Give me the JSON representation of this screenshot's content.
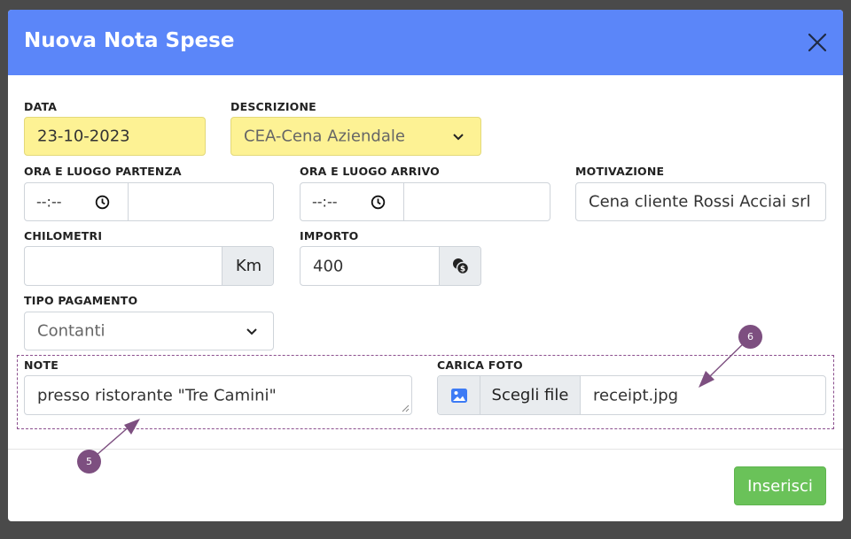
{
  "modal": {
    "title": "Nuova Nota Spese",
    "submit_label": "Inserisci"
  },
  "fields": {
    "data": {
      "label": "DATA",
      "value": "23-10-2023"
    },
    "descrizione": {
      "label": "DESCRIZIONE",
      "value": "CEA-Cena Aziendale"
    },
    "partenza": {
      "label": "ORA E LUOGO PARTENZA",
      "time": "--:--",
      "place": ""
    },
    "arrivo": {
      "label": "ORA E LUOGO ARRIVO",
      "time": "--:--",
      "place": ""
    },
    "motivazione": {
      "label": "MOTIVAZIONE",
      "value": "Cena cliente Rossi Acciai srl"
    },
    "chilometri": {
      "label": "CHILOMETRI",
      "value": "",
      "unit": "Km"
    },
    "importo": {
      "label": "IMPORTO",
      "value": "400"
    },
    "tipo_pagamento": {
      "label": "TIPO PAGAMENTO",
      "value": "Contanti"
    },
    "note": {
      "label": "NOTE",
      "value": "presso ristorante \"Tre Camini\""
    },
    "foto": {
      "label": "CARICA FOTO",
      "button": "Scegli file",
      "filename": "receipt.jpg"
    }
  },
  "annotations": {
    "badge_note": "5",
    "badge_foto": "6"
  },
  "colors": {
    "header": "#5b86f9",
    "highlight": "#fdf294",
    "submit": "#6ac259",
    "annotation": "#7d4f80"
  }
}
